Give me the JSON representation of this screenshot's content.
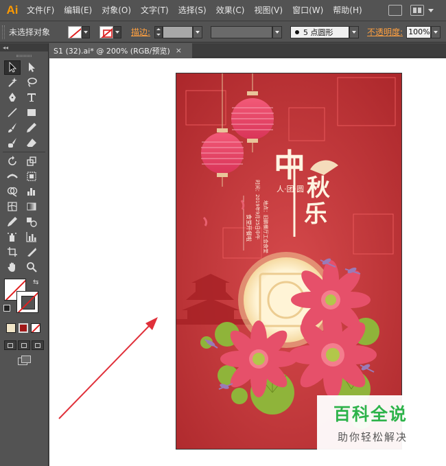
{
  "app": {
    "logo": "Ai"
  },
  "menu": [
    "文件(F)",
    "编辑(E)",
    "对象(O)",
    "文字(T)",
    "选择(S)",
    "效果(C)",
    "视图(V)",
    "窗口(W)",
    "帮助(H)"
  ],
  "control_bar": {
    "selection_label": "未选择对象",
    "stroke_label": "描边:",
    "brush_value": "5 点圆形",
    "opacity_label": "不透明度:",
    "opacity_value": "100%"
  },
  "toolbox": {
    "collapse_glyph": "◂◂"
  },
  "document_tab": {
    "title": "S1 (32).ai* @ 200% (RGB/预览)",
    "close": "×"
  },
  "artwork": {
    "title_chars": [
      "中",
      "秋",
      "乐"
    ],
    "subtitle": "人·团·圆",
    "location_text": "地点：旧鹏餐厅工会食堂",
    "time_text": "时间：2019年9月25日中午",
    "badge_text": "食堂开餐啦",
    "colors": {
      "background": "#c0393b",
      "moon": "#fbeec9",
      "lantern": "#e8506a",
      "flower": "#e8506a",
      "leaf": "#8fb43a"
    }
  },
  "watermark": {
    "title": "百科全说",
    "subtitle": "助你轻松解决"
  }
}
